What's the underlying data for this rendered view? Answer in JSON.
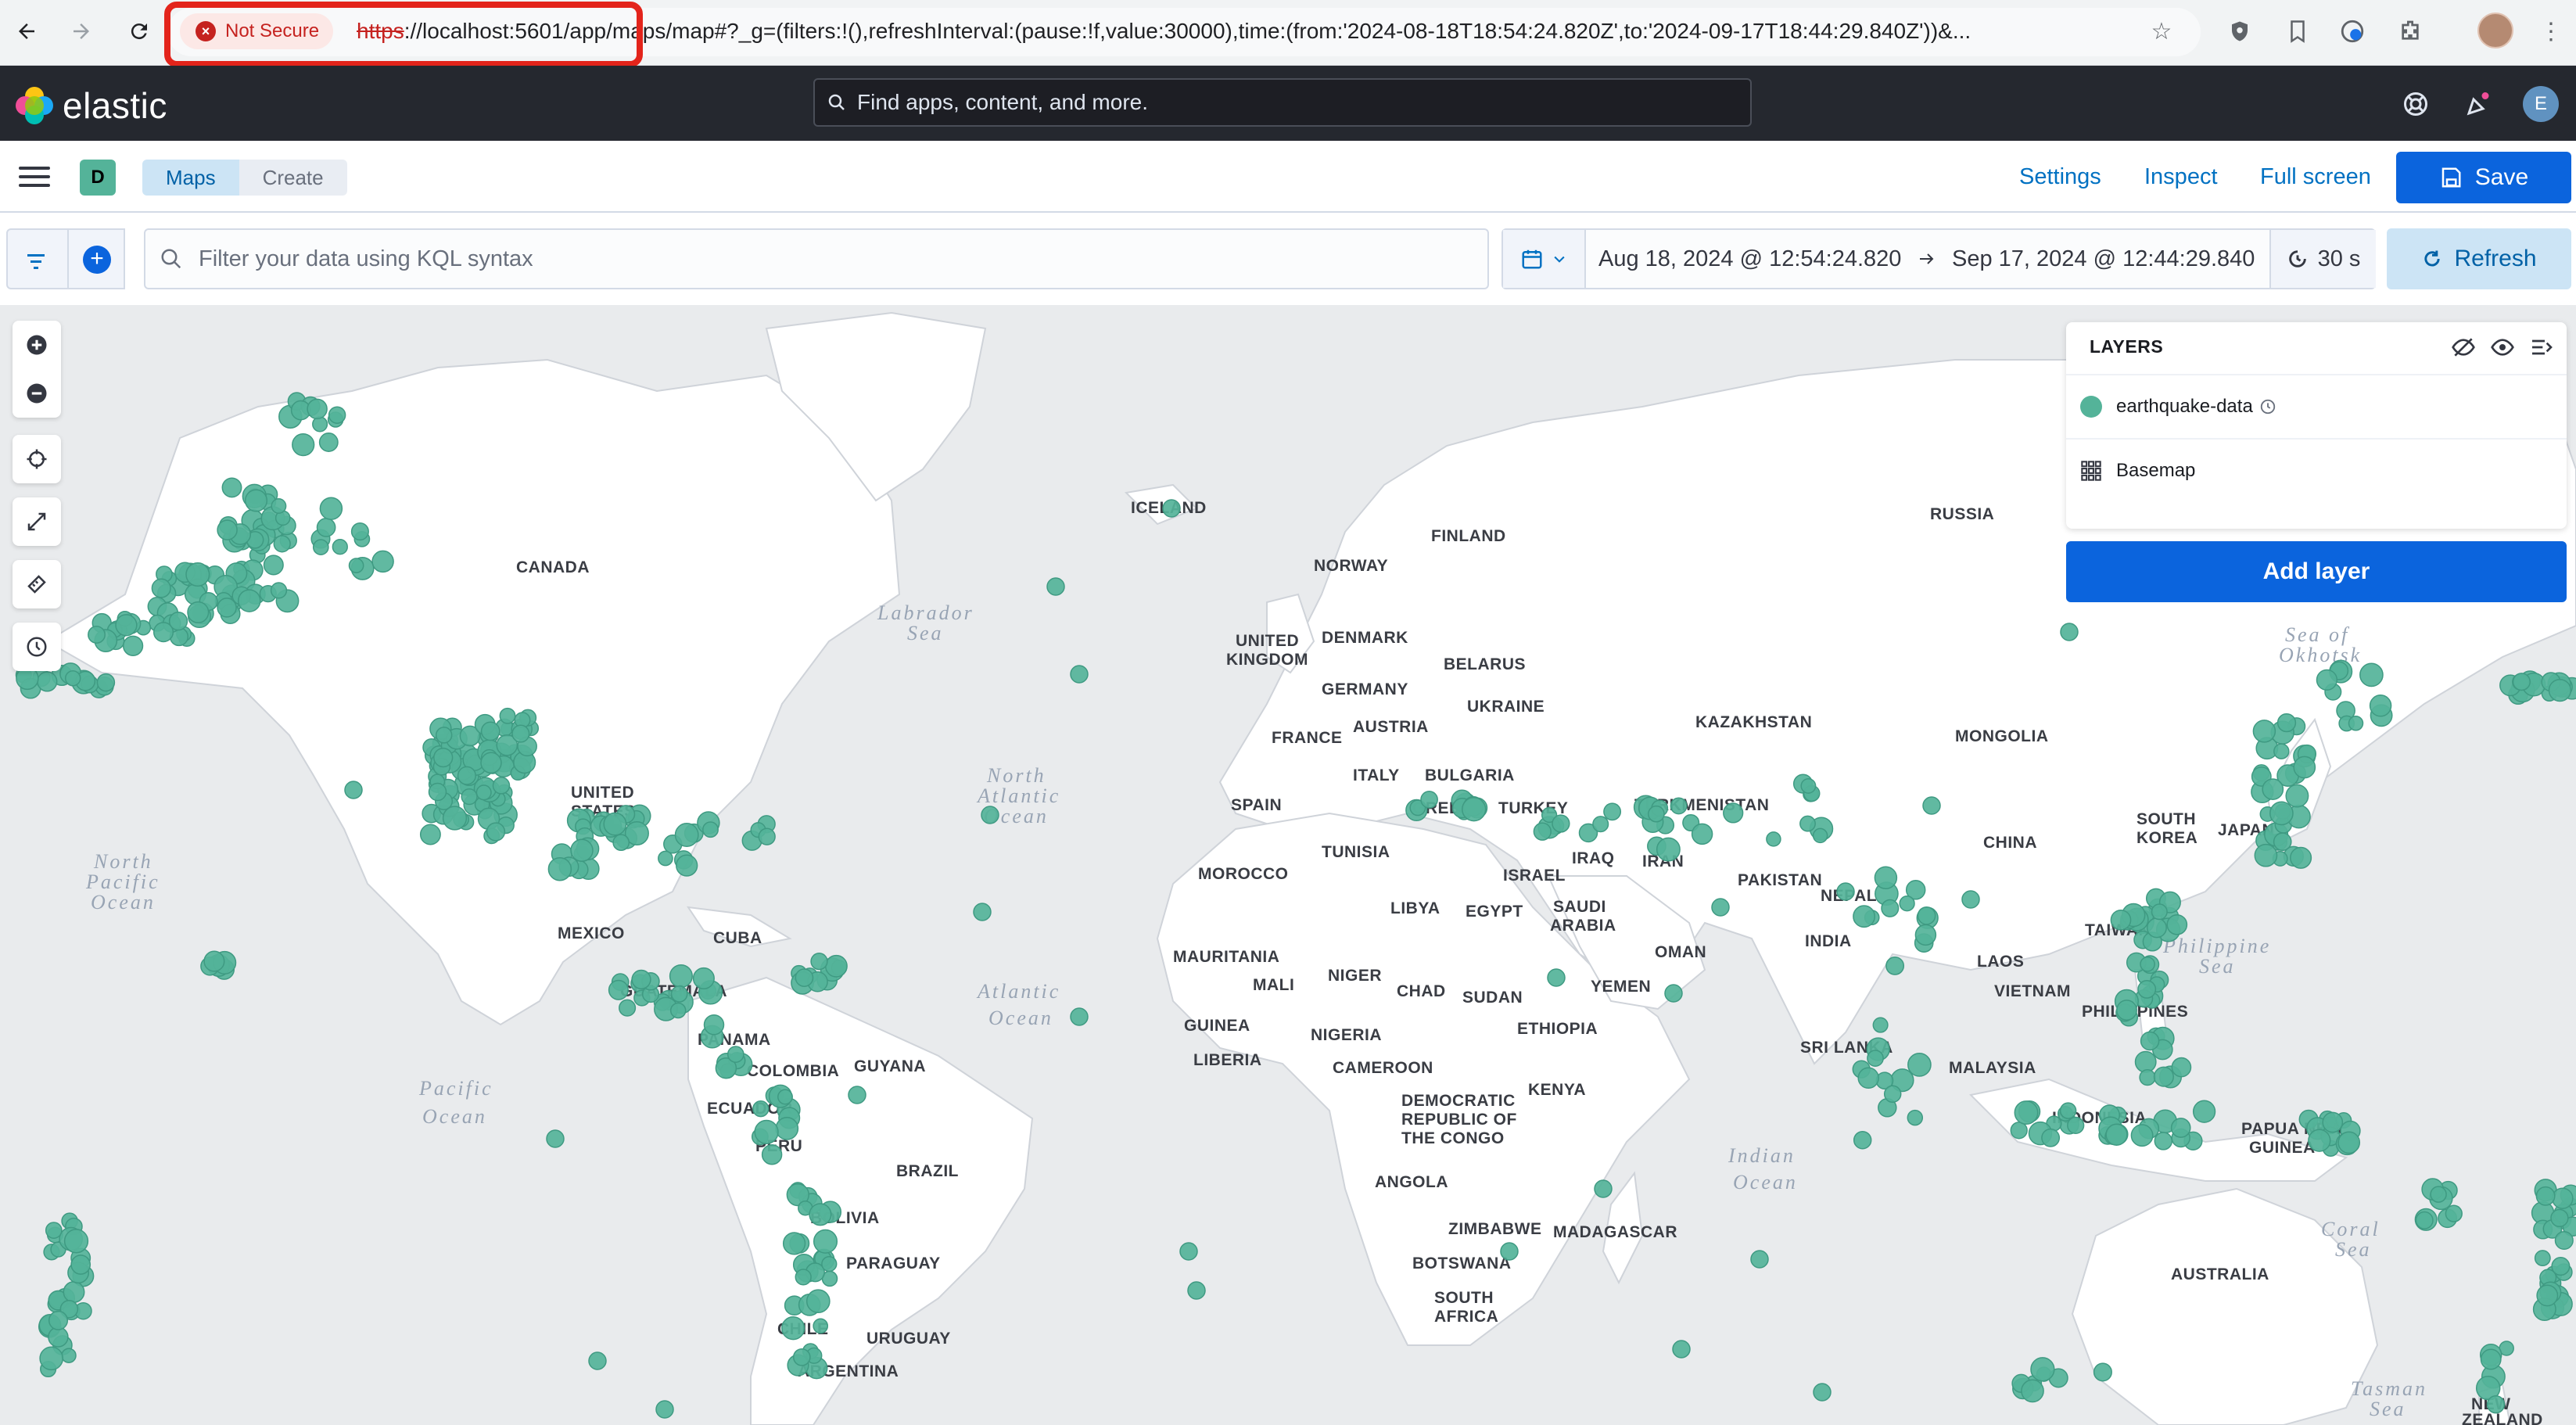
{
  "browser": {
    "not_secure_label": "Not Secure",
    "url_scheme": "https",
    "url_rest": "://localhost:5601/app/maps/map#?_g=(filters:!(),refreshInterval:(pause:!f,value:30000),time:(from:'2024-08-18T18:54:24.820Z',to:'2024-09-17T18:44:29.840Z'))&..."
  },
  "header": {
    "brand": "elastic",
    "search_placeholder": "Find apps, content, and more.",
    "user_initial": "E"
  },
  "app_bar": {
    "space_initial": "D",
    "breadcrumbs": [
      "Maps",
      "Create"
    ],
    "links": {
      "settings": "Settings",
      "inspect": "Inspect",
      "full_screen": "Full screen"
    },
    "save_label": "Save"
  },
  "query_bar": {
    "kql_placeholder": "Filter your data using KQL syntax",
    "date_from": "Aug 18, 2024 @ 12:54:24.820",
    "date_to": "Sep 17, 2024 @ 12:44:29.840",
    "refresh_interval": "30 s",
    "refresh_label": "Refresh"
  },
  "layers": {
    "title": "LAYERS",
    "items": [
      {
        "name": "earthquake-data",
        "color": "#54b399"
      },
      {
        "name": "Basemap"
      }
    ],
    "add_layer_label": "Add layer"
  },
  "map_labels": {
    "countries": [
      "CANADA",
      "UNITED STATES",
      "MEXICO",
      "CUBA",
      "GUATEMALA",
      "PANAMA",
      "COLOMBIA",
      "GUYANA",
      "ECUADOR",
      "PERU",
      "BRAZIL",
      "BOLIVIA",
      "PARAGUAY",
      "CHILE",
      "URUGUAY",
      "ARGENTINA",
      "ICELAND",
      "NORWAY",
      "FINLAND",
      "UNITED KINGDOM",
      "DENMARK",
      "GERMANY",
      "BELARUS",
      "UKRAINE",
      "AUSTRIA",
      "FRANCE",
      "ITALY",
      "BULGARIA",
      "SPAIN",
      "GREECE",
      "TURKEY",
      "TUNISIA",
      "MOROCCO",
      "LIBYA",
      "EGYPT",
      "ISRAEL",
      "IRAQ",
      "IRAN",
      "TURKMENISTAN",
      "KAZAKHSTAN",
      "MONGOLIA",
      "RUSSIA",
      "CHINA",
      "SOUTH KOREA",
      "JAPAN",
      "PAKISTAN",
      "NEPAL",
      "INDIA",
      "SAUDI ARABIA",
      "OMAN",
      "YEMEN",
      "SUDAN",
      "ETHIOPIA",
      "CHAD",
      "NIGER",
      "MALI",
      "MAURITANIA",
      "GUINEA",
      "LIBERIA",
      "NIGERIA",
      "CAMEROON",
      "DEMOCRATIC REPUBLIC OF THE CONGO",
      "KENYA",
      "ANGOLA",
      "ZIMBABWE",
      "BOTSWANA",
      "SOUTH AFRICA",
      "MADAGASCAR",
      "SRI LANKA",
      "LAOS",
      "VIETNAM",
      "TAIWAN",
      "PHILIPPINES",
      "MALAYSIA",
      "INDONESIA",
      "PAPUA NEW GUINEA",
      "AUSTRALIA",
      "NEW ZEALAND"
    ],
    "oceans": [
      "North Pacific Ocean",
      "Pacific Ocean",
      "North Atlantic Ocean",
      "Atlantic Ocean",
      "Labrador Sea",
      "Indian Ocean",
      "Philippine Sea",
      "Sea of Okhotsk",
      "Coral Sea",
      "Tasman Sea"
    ]
  },
  "colors": {
    "accent": "#0b64dd",
    "quake_point": "#54b399",
    "header_bg": "#25282f",
    "not_secure": "#c5221f",
    "highlight_box": "#e3241b"
  }
}
